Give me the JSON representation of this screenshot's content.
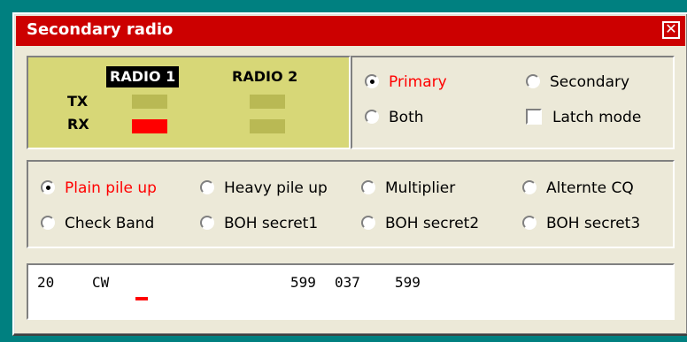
{
  "window": {
    "title": "Secondary radio",
    "close_glyph": "✕"
  },
  "radio_indicator": {
    "radio1_label": "RADIO 1",
    "radio2_label": "RADIO 2",
    "tx_label": "TX",
    "rx_label": "RX",
    "active_radio": "RADIO 1",
    "led_on_color": "#ff0000",
    "led_off_color": "#b9b954",
    "panel_color": "#d7d777"
  },
  "mode": {
    "primary": "Primary",
    "secondary": "Secondary",
    "both": "Both",
    "latch": "Latch mode",
    "selected": "Primary",
    "latch_checked": false
  },
  "pile": {
    "options": [
      "Plain pile up",
      "Heavy pile up",
      "Multiplier",
      "Alternte CQ",
      "Check Band",
      "BOH secret1",
      "BOH secret2",
      "BOH secret3"
    ],
    "selected": "Plain pile up"
  },
  "log": {
    "band": "20",
    "mode": "CW",
    "rst_sent": "599",
    "serial": "037",
    "rst_rcvd": "599"
  },
  "colors": {
    "title_bar": "#cc0000",
    "active_text": "#ff0000",
    "background": "#ece9d8",
    "desktop": "#008080"
  }
}
